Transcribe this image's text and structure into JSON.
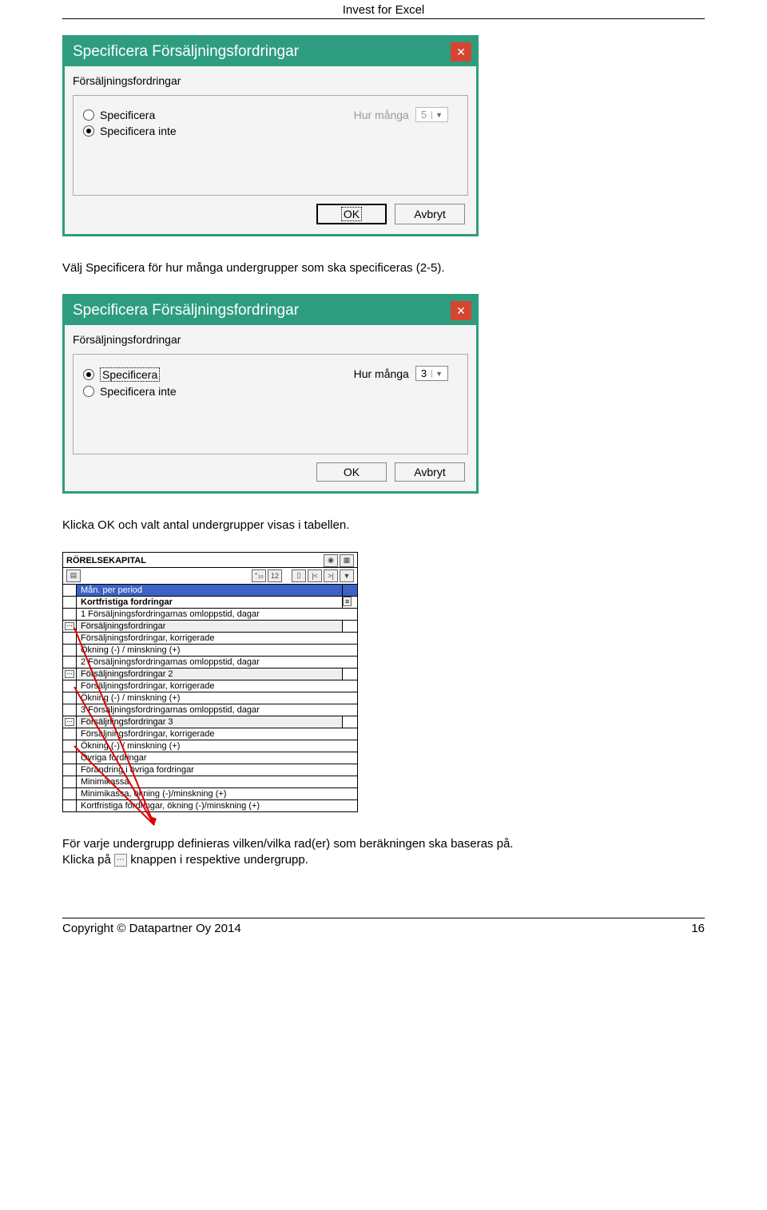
{
  "doc": {
    "header": "Invest for Excel",
    "copyright": "Copyright © Datapartner Oy 2014",
    "pageno": "16"
  },
  "dialog1": {
    "title": "Specificera Försäljningsfordringar",
    "heading": "Försäljningsfordringar",
    "opt1": "Specificera",
    "opt2": "Specificera inte",
    "qtylabel": "Hur många",
    "qtyval": "5",
    "ok": "OK",
    "cancel": "Avbryt"
  },
  "para1": "Välj Specificera för hur många undergrupper som ska specificeras (2-5).",
  "dialog2": {
    "title": "Specificera Försäljningsfordringar",
    "heading": "Försäljningsfordringar",
    "opt1": "Specificera",
    "opt2": "Specificera inte",
    "qtylabel": "Hur många",
    "qtyval": "3",
    "ok": "OK",
    "cancel": "Avbryt"
  },
  "para2": "Klicka OK och valt antal undergrupper visas i tabellen.",
  "table": {
    "title": "RÖRELSEKAPITAL",
    "rows": [
      "Mån. per period",
      "Kortfristiga fordringar",
      "1 Försäljningsfordringarnas omloppstid, dagar",
      "Försäljningsfordringar",
      "Försäljningsfordringar, korrigerade",
      "Ökning (-) / minskning (+)",
      "2 Försäljningsfordringarnas omloppstid, dagar",
      "Försäljningsfordringar 2",
      "Försäljningsfordringar, korrigerade",
      "Ökning (-) / minskning (+)",
      "3 Försäljningsfordringarnas omloppstid, dagar",
      "Försäljningsfordringar 3",
      "Försäljningsfordringar, korrigerade",
      "Ökning (-) / minskning (+)",
      "Övriga fordringar",
      "Förändring i övriga fordringar",
      "Minimikassa",
      "Minimikassa, ökning (-)/minskning (+)",
      "Kortfristiga fordringar, ökning (-)/minskning (+)"
    ]
  },
  "para3a": "För varje undergrupp definieras vilken/vilka rad(er) som beräkningen ska baseras på.",
  "para3b_pre": "Klicka på ",
  "para3b_post": " knappen i respektive undergrupp."
}
